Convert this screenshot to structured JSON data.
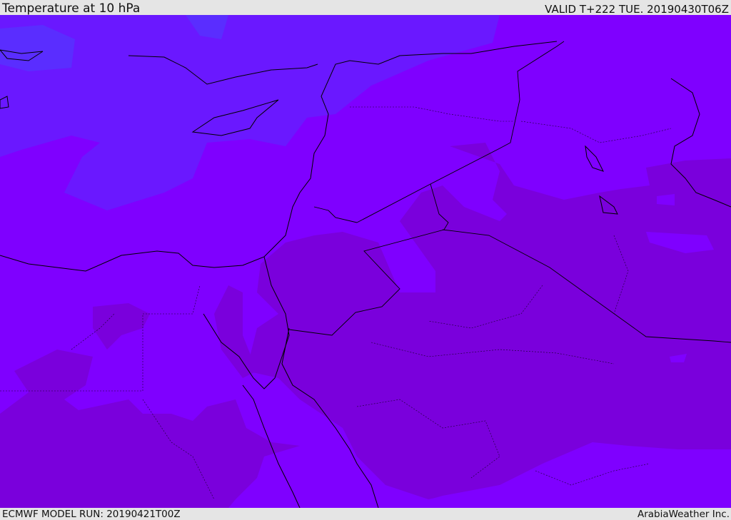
{
  "header": {
    "title": "Temperature at 10 hPa",
    "valid": "VALID T+222 TUE. 20190430T06Z"
  },
  "footer": {
    "model_run": "ECMWF MODEL RUN: 20190421T00Z",
    "credit": "ArabiaWeather Inc."
  },
  "colors": {
    "cold_patch": "#5a2dff",
    "cool": "#6a18ff",
    "mid": "#7f00ff",
    "warm": "#7a00dc",
    "coast": "#000000"
  }
}
